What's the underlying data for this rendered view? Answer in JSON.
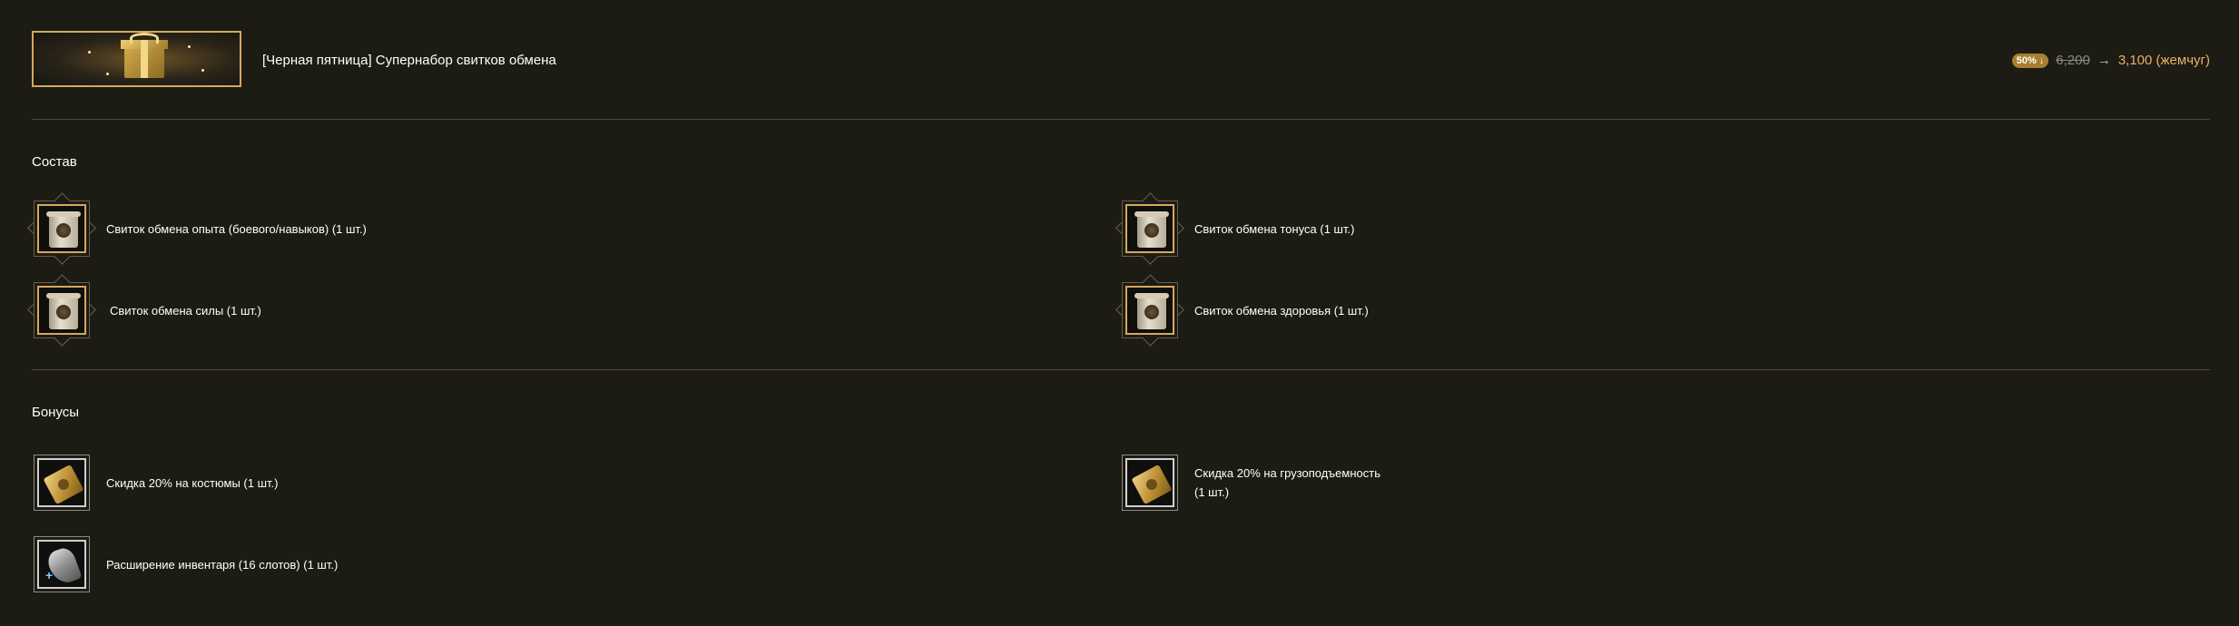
{
  "header": {
    "title": "[Черная пятница] Супернабор свитков обмена",
    "discount_badge": "50%",
    "discount_arrow": "↓",
    "old_price": "6,200",
    "arrow": "→",
    "new_price": "3,100 (жемчуг)"
  },
  "composition": {
    "title": "Состав",
    "items": [
      {
        "label": "Свиток обмена опыта (боевого/навыков) (1 шт.)",
        "icon": "scroll-icon"
      },
      {
        "label": "Свиток обмена тонуса (1 шт.)",
        "icon": "scroll-icon"
      },
      {
        "label": "Свиток обмена силы (1 шт.)",
        "icon": "scroll-icon"
      },
      {
        "label": "Свиток обмена здоровья (1 шт.)",
        "icon": "scroll-icon"
      }
    ]
  },
  "bonuses": {
    "title": "Бонусы",
    "items": [
      {
        "label": "Скидка 20% на костюмы (1 шт.)",
        "icon": "coupon-icon"
      },
      {
        "label_line1": "Скидка 20% на грузоподъемность",
        "label_line2": "(1 шт.)",
        "icon": "coupon-icon"
      },
      {
        "label": "Расширение инвентаря (16 слотов) (1 шт.)",
        "icon": "inventory-bag-icon"
      }
    ]
  },
  "colors": {
    "background": "#1c1c15",
    "accent_gold": "#d7a75c",
    "price_gold": "#e7b262",
    "badge": "#a8802d",
    "divider": "#4e4a38"
  }
}
